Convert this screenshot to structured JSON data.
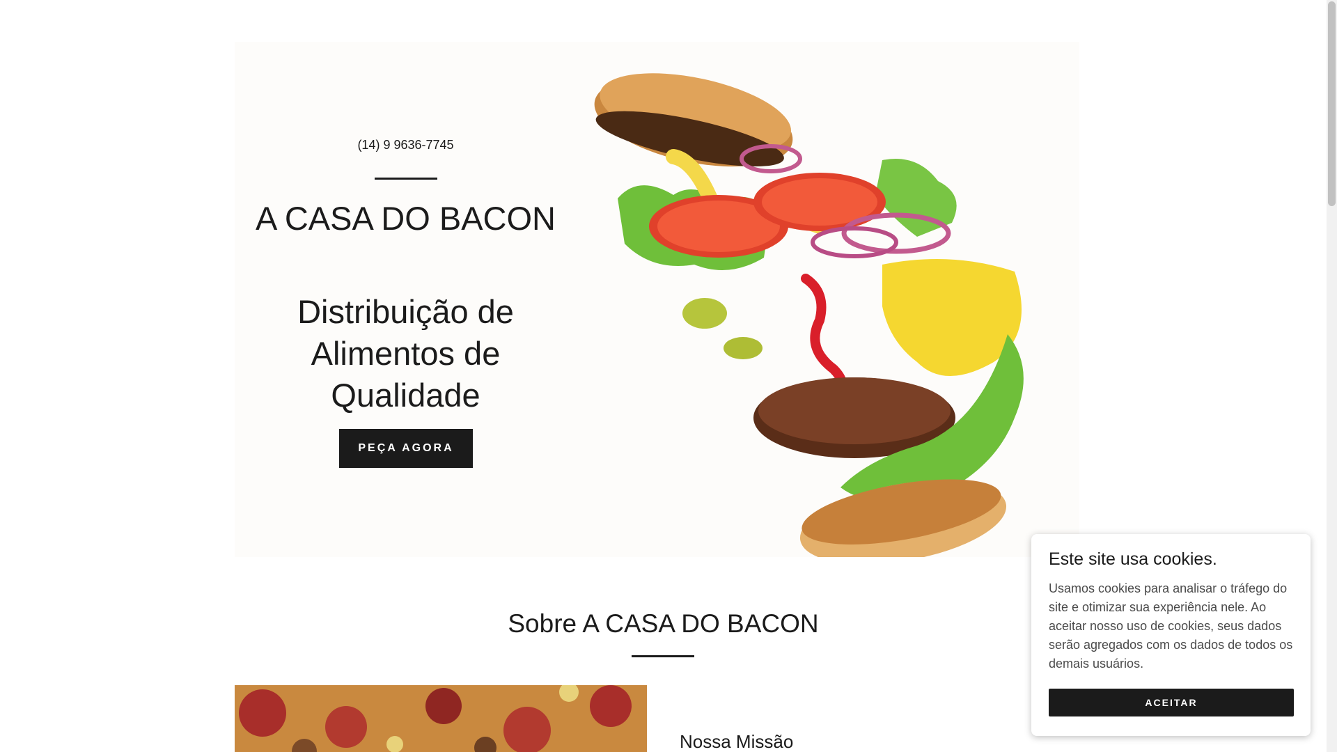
{
  "hero": {
    "phone": "(14) 9 9636-7745",
    "site_title": "A CASA DO BACON",
    "tagline": "Distribuição de Alimentos de Qualidade",
    "cta_label": "PEÇA AGORA"
  },
  "about": {
    "title": "Sobre A CASA DO BACON",
    "mission_title": "Nossa Missão"
  },
  "cookie_banner": {
    "title": "Este site usa cookies.",
    "text": "Usamos cookies para analisar o tráfego do site e otimizar sua experiência nele. Ao aceitar nosso uso de cookies, seus dados serão agregados com os dados de todos os demais usuários.",
    "accept_label": "ACEITAR"
  }
}
